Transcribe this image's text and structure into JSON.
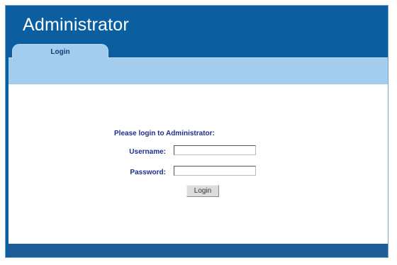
{
  "header": {
    "title": "Administrator"
  },
  "tabs": [
    {
      "label": "Login",
      "active": true
    }
  ],
  "login_form": {
    "prompt": "Please login to Administrator:",
    "username_label": "Username:",
    "username_value": "",
    "password_label": "Password:",
    "password_value": "",
    "submit_label": "Login"
  },
  "colors": {
    "header_background": "#0b5fa0",
    "tab_background": "#a3cdee",
    "label_text": "#1d2d8c"
  }
}
